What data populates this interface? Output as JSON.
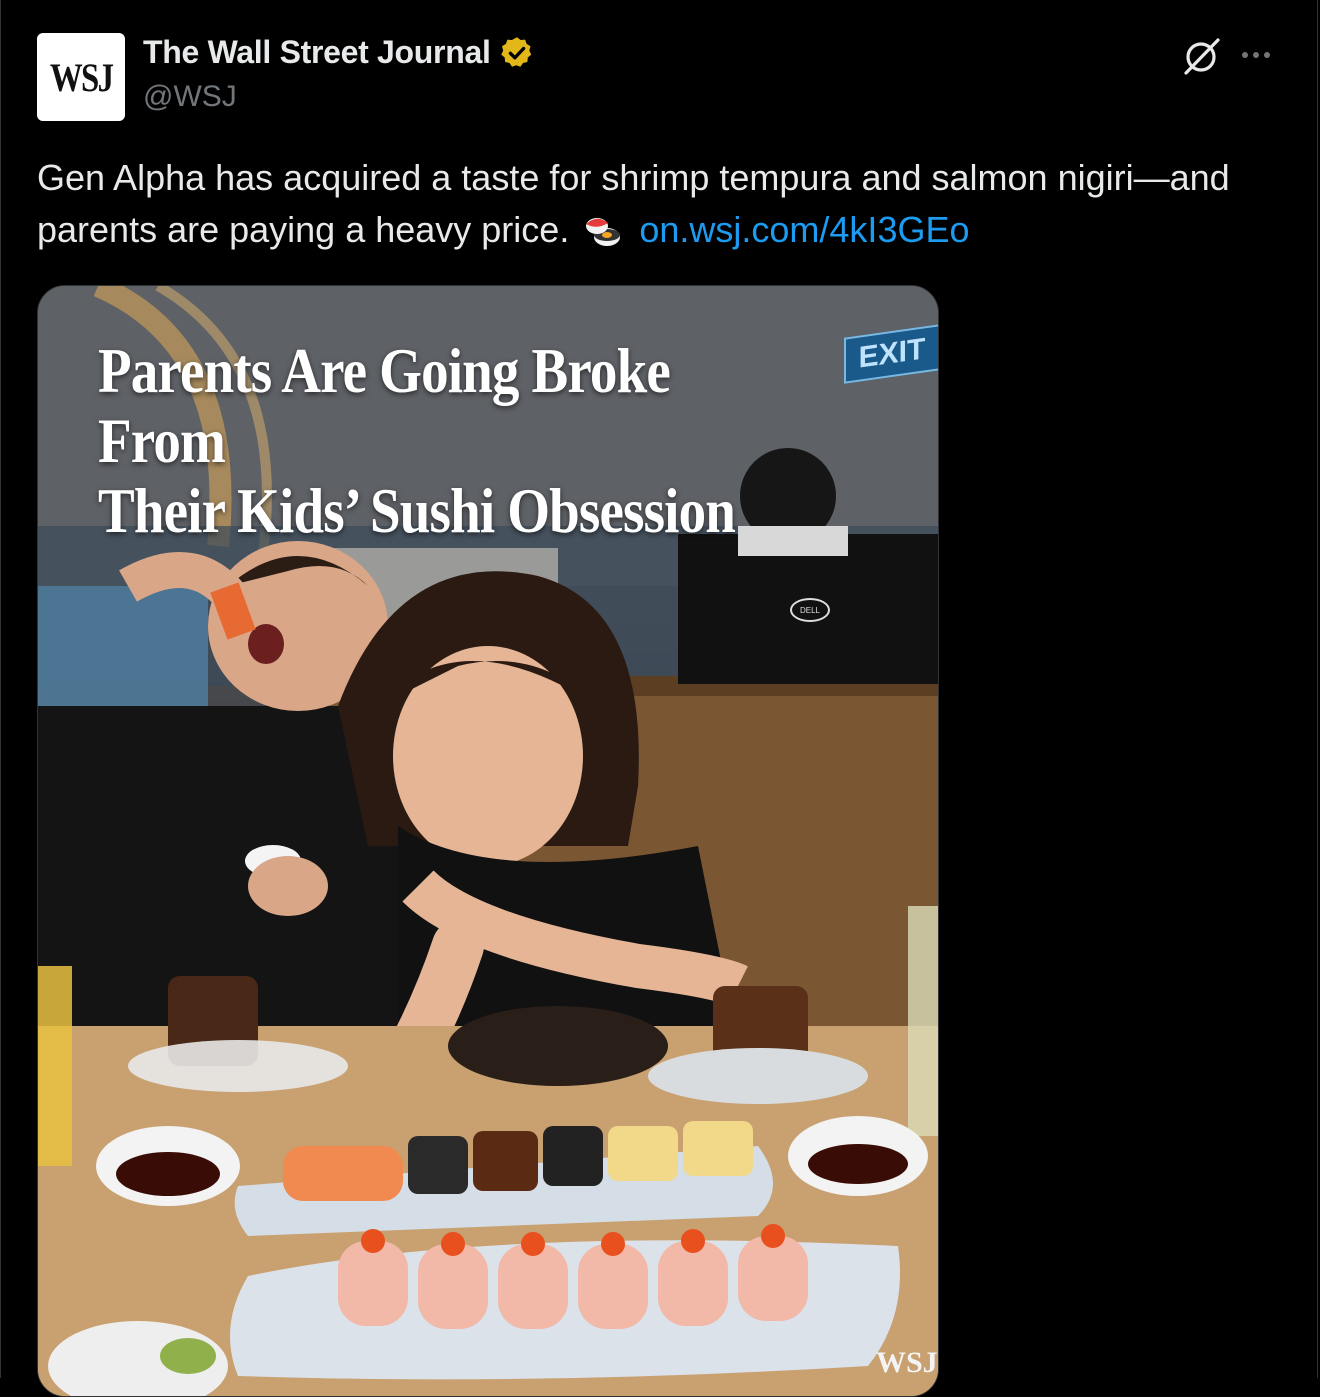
{
  "account": {
    "avatar_text": "WSJ",
    "name": "The Wall Street Journal",
    "handle": "@WSJ",
    "verified_badge_color": "#e2b719"
  },
  "icons": {
    "grok": "grok-icon",
    "more": "more-icon",
    "emoji": "sushi-emoji"
  },
  "tweet": {
    "text": "Gen Alpha has acquired a taste for shrimp tempura and salmon nigiri—and parents are paying a heavy price.",
    "link": "on.wsj.com/4kI3GEo",
    "link_color": "#1d9bf0"
  },
  "media": {
    "headline_line1": "Parents Are Going Broke From",
    "headline_line2": "Their Kids’ Sushi Obsession",
    "exit_sign": "EXIT",
    "monitor_brand": "DELL",
    "watermark": "WSJ"
  }
}
